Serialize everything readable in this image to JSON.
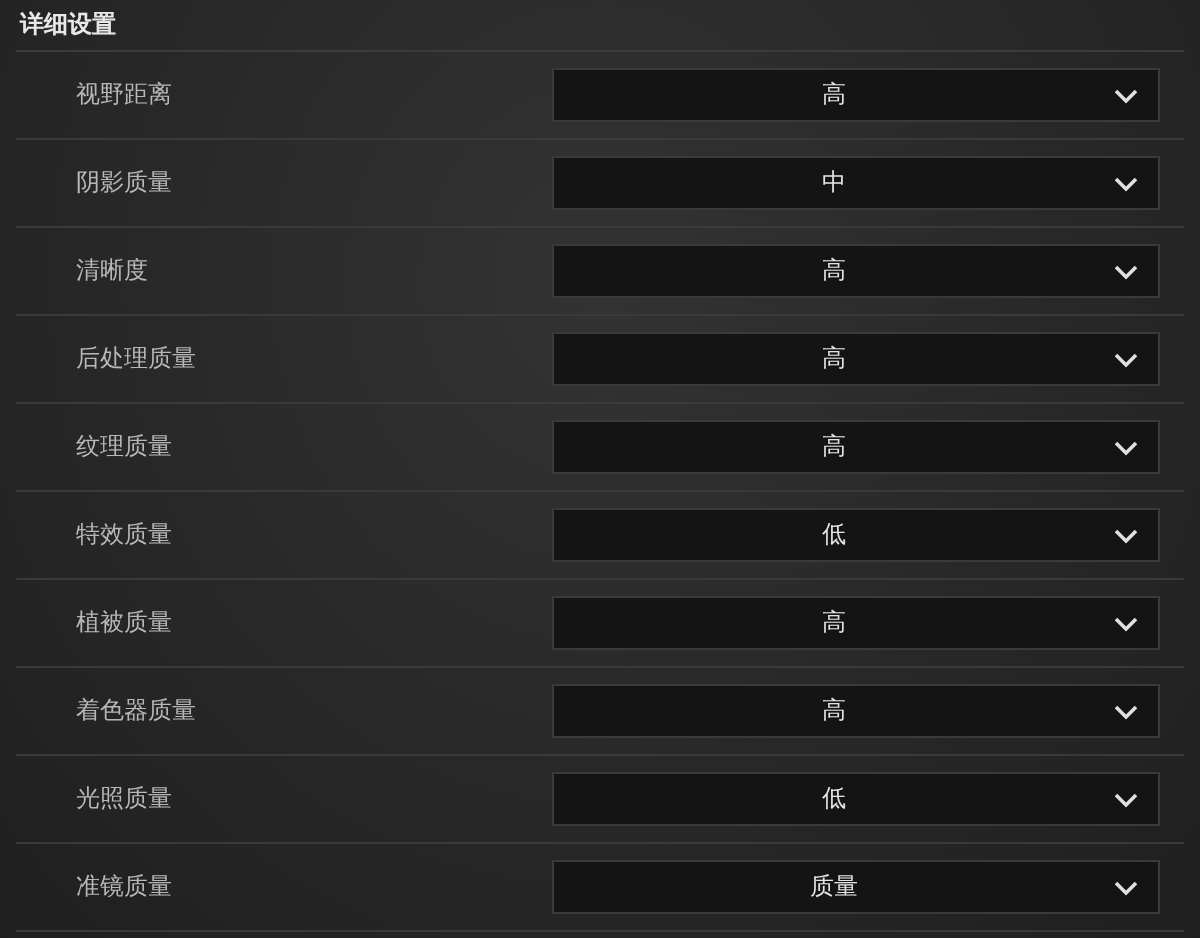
{
  "section_title": "详细设置",
  "settings": [
    {
      "label": "视野距离",
      "value": "高"
    },
    {
      "label": "阴影质量",
      "value": "中"
    },
    {
      "label": "清晰度",
      "value": "高"
    },
    {
      "label": "后处理质量",
      "value": "高"
    },
    {
      "label": "纹理质量",
      "value": "高"
    },
    {
      "label": "特效质量",
      "value": "低"
    },
    {
      "label": "植被质量",
      "value": "高"
    },
    {
      "label": "着色器质量",
      "value": "高"
    },
    {
      "label": "光照质量",
      "value": "低"
    },
    {
      "label": "准镜质量",
      "value": "质量"
    }
  ]
}
